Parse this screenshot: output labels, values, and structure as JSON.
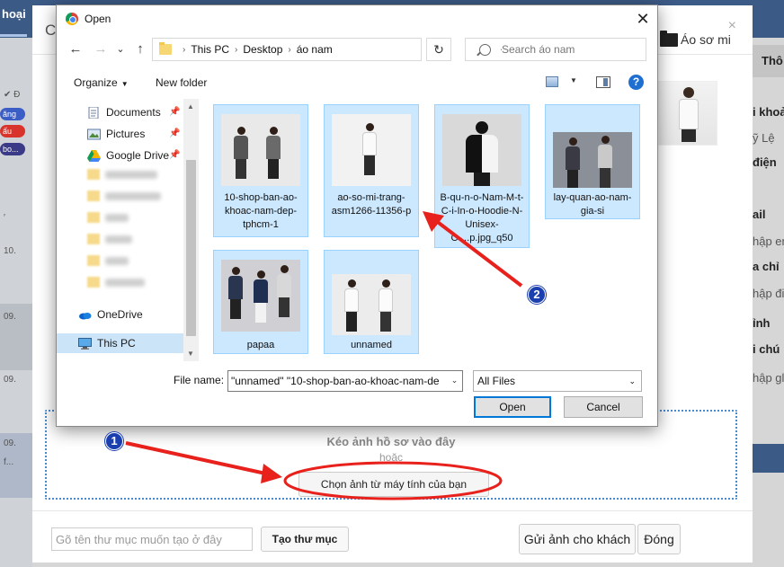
{
  "background": {
    "top_tab": "hoại",
    "left_badges": [
      {
        "text": "ăng",
        "color": "#3b5ec6"
      },
      {
        "text": "ấu",
        "color": "#d9342b"
      },
      {
        "text": "bo...",
        "color": "#3a3a86"
      }
    ],
    "left_dates": [
      "10.",
      "09.",
      "09.",
      "09."
    ],
    "left_misc": [
      "f..."
    ],
    "right_panel": {
      "header": "Thô",
      "labels": [
        "i khoả",
        "ỹ Lệ",
        "điện",
        "ail",
        "a chỉ",
        "ỉnh",
        "i chú"
      ],
      "placeholders": [
        "hập em",
        "hập đia",
        "hập gl"
      ]
    }
  },
  "modal": {
    "title_initial": "C",
    "close_glyph": "×",
    "folder_name": "Áo sơ mi",
    "dropzone": {
      "hint": "Kéo ảnh hồ sơ vào đây",
      "or": "hoặc",
      "choose_button": "Chọn ảnh từ máy tính của bạn"
    },
    "footer": {
      "folder_input_placeholder": "Gõ tên thư mục muốn tạo ở đây",
      "create_folder_button": "Tạo thư mục",
      "send_button": "Gửi ảnh cho khách",
      "close_button": "Đóng"
    }
  },
  "dialog": {
    "title": "Open",
    "close_glyph": "✕",
    "nav": {
      "back": "←",
      "forward": "→",
      "dropdown": "⌄",
      "up": "↑",
      "breadcrumb": [
        "This PC",
        "Desktop",
        "áo nam"
      ],
      "refresh": "↻",
      "search_placeholder": "Search áo nam"
    },
    "toolbar": {
      "organize": "Organize",
      "new_folder": "New folder",
      "help": "?"
    },
    "nav_pane": {
      "items": [
        {
          "label": "Documents",
          "icon": "documents-icon",
          "pinned": true
        },
        {
          "label": "Pictures",
          "icon": "pictures-icon",
          "pinned": true
        },
        {
          "label": "Google Drive",
          "icon": "google-drive-icon",
          "pinned": true
        },
        {
          "label": "OneDrive",
          "icon": "onedrive-icon",
          "pinned": false
        },
        {
          "label": "This PC",
          "icon": "this-pc-icon",
          "pinned": false,
          "selected": true
        }
      ]
    },
    "files": [
      {
        "name": "10-shop-ban-ao-khoac-nam-dep-tphcm-1"
      },
      {
        "name": "ao-so-mi-trang-asm1266-11356-p"
      },
      {
        "name": "B-qu-n-o-Nam-M-t-C-i-In-o-Hoodie-N-Unisex-C-...p.jpg_q50"
      },
      {
        "name": "lay-quan-ao-nam-gia-si"
      },
      {
        "name": "papaa"
      },
      {
        "name": "unnamed"
      }
    ],
    "file_name_label": "File name:",
    "file_name_value": "\"unnamed\" \"10-shop-ban-ao-khoac-nam-de",
    "file_type": "All Files",
    "open_button": "Open",
    "cancel_button": "Cancel"
  },
  "annotations": {
    "step1": "1",
    "step2": "2",
    "arrow_color": "#e8211c",
    "badge_color": "#1b3fae"
  }
}
